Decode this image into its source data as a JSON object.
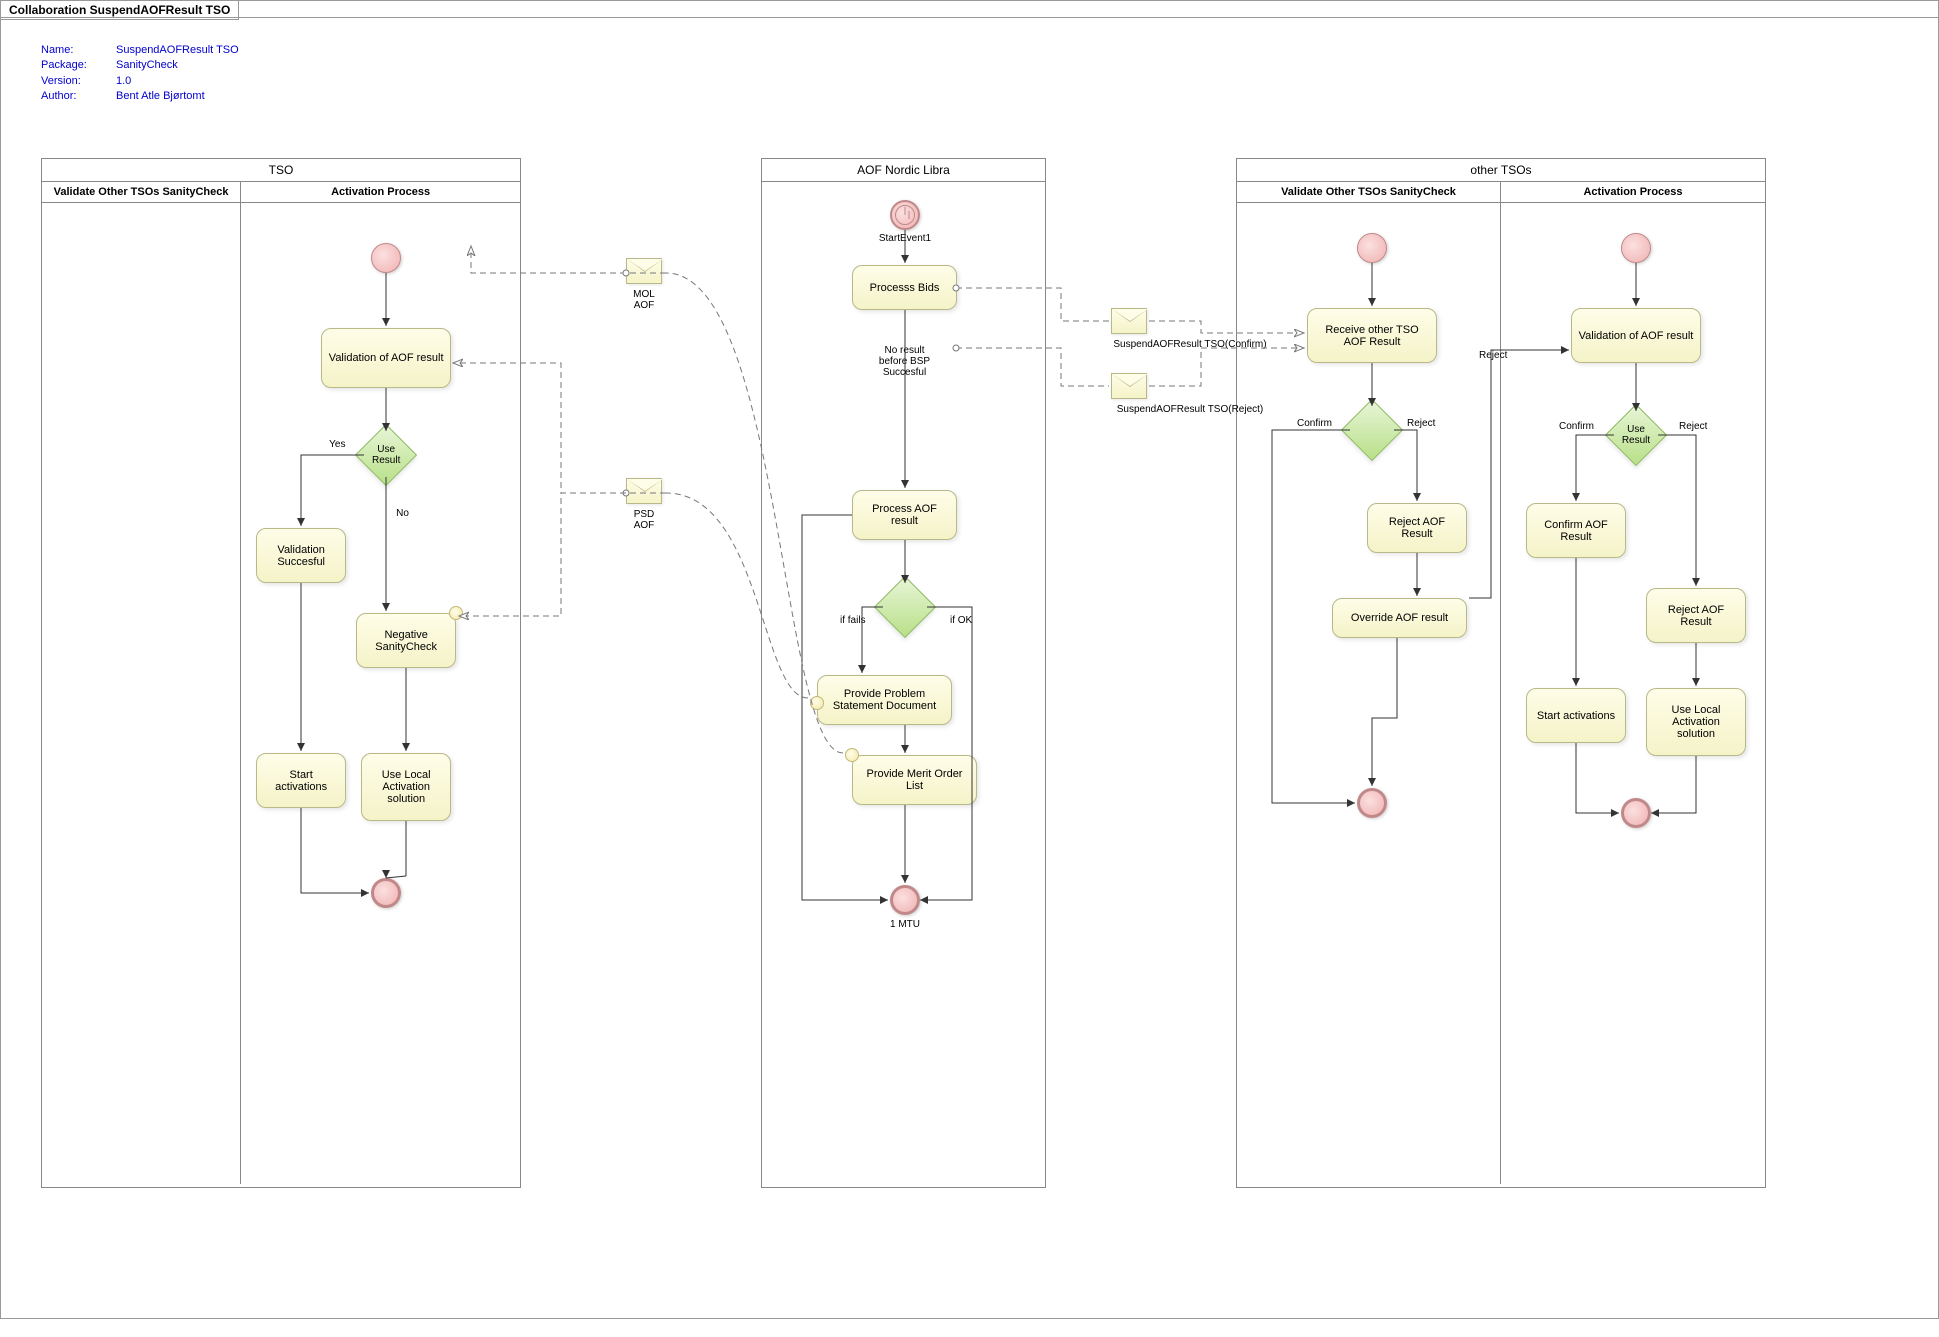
{
  "title": "Collaboration SuspendAOFResult TSO",
  "meta": {
    "name_label": "Name:",
    "name": "SuspendAOFResult TSO",
    "pkg_label": "Package:",
    "pkg": "SanityCheck",
    "ver_label": "Version:",
    "ver": "1.0",
    "auth_label": "Author:",
    "auth": "Bent Atle Bjørtomt"
  },
  "pools": {
    "tso": {
      "title": "TSO",
      "lane1": "Validate Other TSOs SanityCheck",
      "lane2": "Activation Process"
    },
    "aof": {
      "title": "AOF Nordic Libra"
    },
    "other": {
      "title": "other TSOs",
      "lane1": "Validate Other TSOs SanityCheck",
      "lane2": "Activation Process"
    }
  },
  "acts": {
    "t_validate": "Validation of AOF result",
    "t_valsucc": "Validation Succesful",
    "t_negsc": "Negative SanityCheck",
    "t_startact": "Start activations",
    "t_uselocal": "Use Local Activation solution",
    "a_procbids": "Processs Bids",
    "a_procaof": "Process AOF result",
    "a_provpsd": "Provide Problem Statement Document",
    "a_provmol": "Provide Merit Order List",
    "o_recv": "Receive other TSO AOF Result",
    "o_reject": "Reject AOF Result",
    "o_override": "Override AOF result",
    "o_validate": "Validation of AOF result",
    "o_confirm": "Confirm AOF Result",
    "o_reject2": "Reject AOF Result",
    "o_startact": "Start activations",
    "o_uselocal": "Use Local Activation solution"
  },
  "gateways": {
    "use_result": "Use Result"
  },
  "labels": {
    "yes": "Yes",
    "no": "No",
    "confirm": "Confirm",
    "reject": "Reject",
    "if_fails": "if fails",
    "if_ok": "if OK",
    "noresult": "No result before BSP Succesful"
  },
  "events": {
    "start1": "StartEvent1",
    "mtu": "1 MTU"
  },
  "messages": {
    "mol": "MOL AOF",
    "psd": "PSD AOF",
    "confirm": "SuspendAOFResult TSO(Confirm)",
    "reject": "SuspendAOFResult TSO(Reject)"
  }
}
